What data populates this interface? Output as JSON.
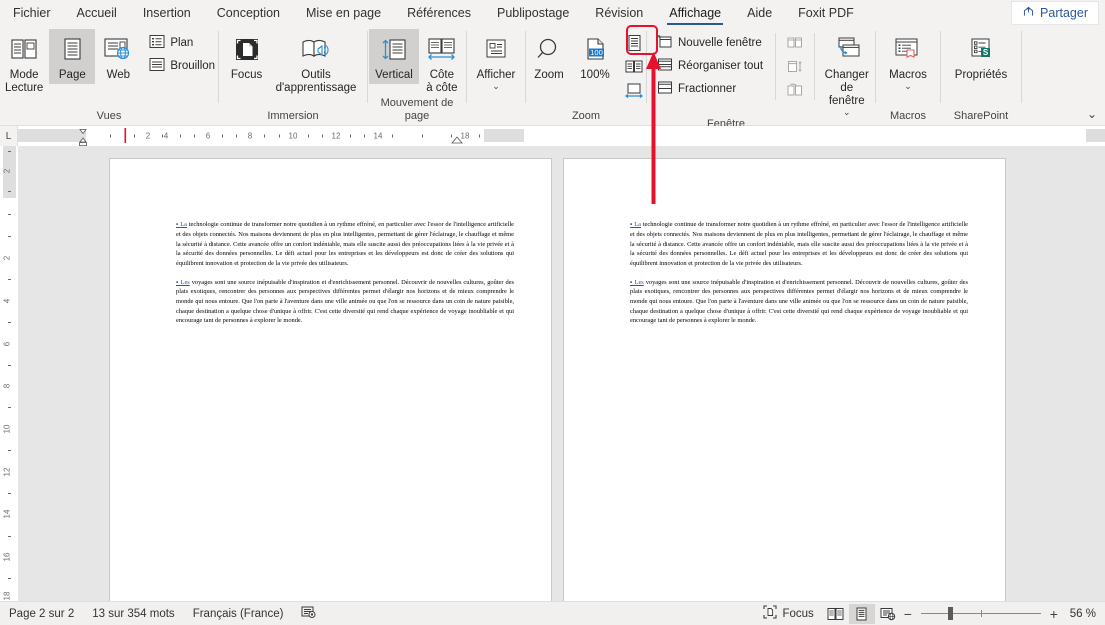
{
  "menubar": {
    "items": [
      {
        "label": "Fichier",
        "active": false
      },
      {
        "label": "Accueil",
        "active": false
      },
      {
        "label": "Insertion",
        "active": false
      },
      {
        "label": "Conception",
        "active": false
      },
      {
        "label": "Mise en page",
        "active": false
      },
      {
        "label": "Références",
        "active": false
      },
      {
        "label": "Publipostage",
        "active": false
      },
      {
        "label": "Révision",
        "active": false
      },
      {
        "label": "Affichage",
        "active": true
      },
      {
        "label": "Aide",
        "active": false
      },
      {
        "label": "Foxit PDF",
        "active": false
      }
    ],
    "share_label": "Partager"
  },
  "ribbon": {
    "groups": [
      {
        "label": "Vues",
        "big_buttons": [
          {
            "label": "Mode\nLecture",
            "icon": "read-mode-icon",
            "selected": false
          },
          {
            "label": "Page",
            "icon": "print-layout-icon",
            "selected": true
          },
          {
            "label": "Web",
            "icon": "web-layout-icon",
            "selected": false
          }
        ],
        "small_buttons": [
          {
            "label": "Plan",
            "icon": "outline-icon"
          },
          {
            "label": "Brouillon",
            "icon": "draft-icon"
          }
        ]
      },
      {
        "label": "Immersion",
        "big_buttons": [
          {
            "label": "Focus",
            "icon": "focus-icon",
            "selected": false
          },
          {
            "label": "Outils\nd'apprentissage",
            "icon": "learning-tools-icon",
            "selected": false
          }
        ],
        "small_buttons": []
      },
      {
        "label": "Mouvement de page",
        "big_buttons": [
          {
            "label": "Vertical",
            "icon": "vertical-scroll-icon",
            "selected": true
          },
          {
            "label": "Côte\nà côte",
            "icon": "side-to-side-icon",
            "selected": false
          }
        ],
        "small_buttons": []
      },
      {
        "label": "",
        "big_buttons": [
          {
            "label": "Afficher",
            "icon": "show-panel-icon",
            "selected": false,
            "dropdown": true
          }
        ],
        "small_buttons": []
      },
      {
        "label": "Zoom",
        "big_buttons": [
          {
            "label": "Zoom",
            "icon": "magnifier-icon",
            "selected": false
          },
          {
            "label": "100%",
            "icon": "zoom-100-icon",
            "selected": false
          }
        ],
        "mini_buttons": [
          {
            "name": "one-page-button",
            "label": "Une page",
            "highlighted": true
          },
          {
            "name": "multiple-pages-button",
            "label": "Plusieurs pages",
            "highlighted": false
          },
          {
            "name": "page-width-button",
            "label": "Largeur de page",
            "highlighted": false
          }
        ],
        "small_buttons": []
      },
      {
        "label": "Fenêtre",
        "big_buttons": [
          {
            "label": "Changer de\nfenêtre",
            "icon": "switch-windows-icon",
            "selected": false,
            "dropdown": true
          }
        ],
        "small_buttons": [
          {
            "label": "Nouvelle fenêtre",
            "icon": "new-window-icon"
          },
          {
            "label": "Réorganiser tout",
            "icon": "arrange-all-icon"
          },
          {
            "label": "Fractionner",
            "icon": "split-icon"
          }
        ],
        "mini_buttons": [
          {
            "name": "view-side-by-side-button",
            "label": "",
            "highlighted": false
          },
          {
            "name": "synchronous-scrolling-button",
            "label": "",
            "highlighted": false
          },
          {
            "name": "reset-window-position-button",
            "label": "",
            "highlighted": false
          }
        ]
      },
      {
        "label": "Macros",
        "big_buttons": [
          {
            "label": "Macros",
            "icon": "macros-icon",
            "selected": false,
            "dropdown": true
          }
        ],
        "small_buttons": []
      },
      {
        "label": "SharePoint",
        "big_buttons": [
          {
            "label": "Propriétés",
            "icon": "properties-icon",
            "selected": false
          }
        ],
        "small_buttons": []
      }
    ],
    "collapse_label": "⌄"
  },
  "rulers": {
    "corner_label": "L",
    "horizontal_ticks": [
      "2",
      "4",
      "6",
      "8",
      "10",
      "12",
      "14",
      "18"
    ],
    "vertical_ticks": [
      "2",
      "2",
      "4",
      "6",
      "8",
      "10",
      "12",
      "14",
      "16",
      "18"
    ]
  },
  "document": {
    "pages": [
      {
        "paragraphs": [
          {
            "bullet": "La",
            "text": " technologie continue de transformer notre quotidien à un rythme effréné, en particulier avec l'essor de l'intelligence artificielle et des objets connectés. Nos maisons deviennent de plus en plus intelligentes, permettant de gérer l'éclairage, le chauffage et même la sécurité à distance. Cette avancée offre un confort indéniable, mais elle suscite aussi des préoccupations liées à la vie privée et à la sécurité des données personnelles. Le défi actuel pour les entreprises et les développeurs est donc de créer des solutions qui équilibrent innovation et protection de la vie privée des utilisateurs."
          },
          {
            "bullet": "Les",
            "text": " voyages sont une source inépuisable d'inspiration et d'enrichissement personnel. Découvrir de nouvelles cultures, goûter des plats exotiques, rencontrer des personnes aux perspectives différentes permet d'élargir nos horizons et de mieux comprendre le monde qui nous entoure. Que l'on parte à l'aventure dans une ville animée ou que l'on se ressource dans un coin de nature paisible, chaque destination a quelque chose d'unique à offrir. C'est cette diversité qui rend chaque expérience de voyage inoubliable et qui encourage tant de personnes à explorer le monde."
          }
        ]
      },
      {
        "paragraphs": [
          {
            "bullet": "La",
            "text": " technologie continue de transformer notre quotidien à un rythme effréné, en particulier avec l'essor de l'intelligence artificielle et des objets connectés. Nos maisons deviennent de plus en plus intelligentes, permettant de gérer l'éclairage, le chauffage et même la sécurité à distance. Cette avancée offre un confort indéniable, mais elle suscite aussi des préoccupations liées à la vie privée et à la sécurité des données personnelles. Le défi actuel pour les entreprises et les développeurs est donc de créer des solutions qui équilibrent innovation et protection de la vie privée des utilisateurs."
          },
          {
            "bullet": "Les",
            "text": " voyages sont une source inépuisable d'inspiration et d'enrichissement personnel. Découvrir de nouvelles cultures, goûter des plats exotiques, rencontrer des personnes aux perspectives différentes permet d'élargir nos horizons et de mieux comprendre le monde qui nous entoure. Que l'on parte à l'aventure dans une ville animée ou que l'on se ressource dans un coin de nature paisible, chaque destination a quelque chose d'unique à offrir. C'est cette diversité qui rend chaque expérience de voyage inoubliable et qui encourage tant de personnes à explorer le monde."
          }
        ]
      }
    ]
  },
  "statusbar": {
    "page_info": "Page 2 sur 2",
    "word_count": "13 sur 354 mots",
    "language": "Français (France)",
    "proofing_icon": "proofing-icon",
    "focus_label": "Focus",
    "views": [
      {
        "name": "read-mode-view-button",
        "selected": false
      },
      {
        "name": "print-layout-view-button",
        "selected": true
      },
      {
        "name": "web-layout-view-button",
        "selected": false
      }
    ],
    "zoom_out": "−",
    "zoom_in": "+",
    "zoom_value": "56 %"
  },
  "annotation": {
    "highlight_target": "one-page-button",
    "color": "#e8112d"
  }
}
